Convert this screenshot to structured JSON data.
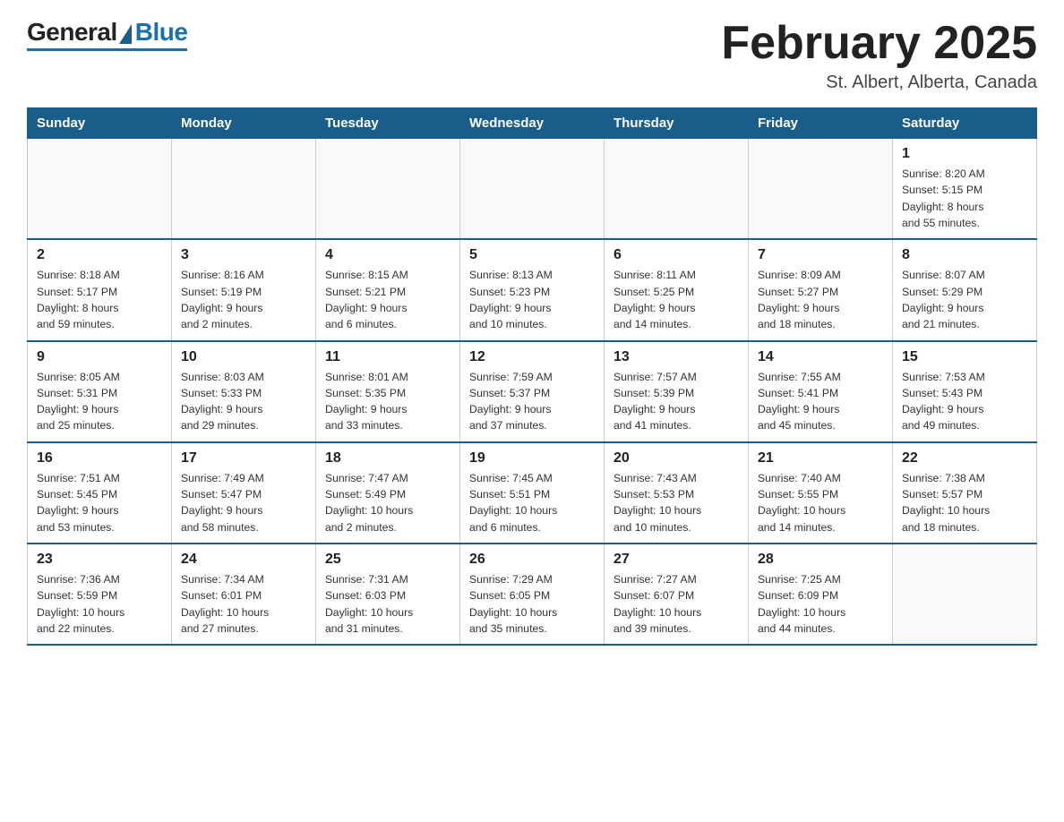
{
  "logo": {
    "general": "General",
    "blue": "Blue"
  },
  "title": "February 2025",
  "location": "St. Albert, Alberta, Canada",
  "days_of_week": [
    "Sunday",
    "Monday",
    "Tuesday",
    "Wednesday",
    "Thursday",
    "Friday",
    "Saturday"
  ],
  "weeks": [
    [
      {
        "day": "",
        "info": ""
      },
      {
        "day": "",
        "info": ""
      },
      {
        "day": "",
        "info": ""
      },
      {
        "day": "",
        "info": ""
      },
      {
        "day": "",
        "info": ""
      },
      {
        "day": "",
        "info": ""
      },
      {
        "day": "1",
        "info": "Sunrise: 8:20 AM\nSunset: 5:15 PM\nDaylight: 8 hours\nand 55 minutes."
      }
    ],
    [
      {
        "day": "2",
        "info": "Sunrise: 8:18 AM\nSunset: 5:17 PM\nDaylight: 8 hours\nand 59 minutes."
      },
      {
        "day": "3",
        "info": "Sunrise: 8:16 AM\nSunset: 5:19 PM\nDaylight: 9 hours\nand 2 minutes."
      },
      {
        "day": "4",
        "info": "Sunrise: 8:15 AM\nSunset: 5:21 PM\nDaylight: 9 hours\nand 6 minutes."
      },
      {
        "day": "5",
        "info": "Sunrise: 8:13 AM\nSunset: 5:23 PM\nDaylight: 9 hours\nand 10 minutes."
      },
      {
        "day": "6",
        "info": "Sunrise: 8:11 AM\nSunset: 5:25 PM\nDaylight: 9 hours\nand 14 minutes."
      },
      {
        "day": "7",
        "info": "Sunrise: 8:09 AM\nSunset: 5:27 PM\nDaylight: 9 hours\nand 18 minutes."
      },
      {
        "day": "8",
        "info": "Sunrise: 8:07 AM\nSunset: 5:29 PM\nDaylight: 9 hours\nand 21 minutes."
      }
    ],
    [
      {
        "day": "9",
        "info": "Sunrise: 8:05 AM\nSunset: 5:31 PM\nDaylight: 9 hours\nand 25 minutes."
      },
      {
        "day": "10",
        "info": "Sunrise: 8:03 AM\nSunset: 5:33 PM\nDaylight: 9 hours\nand 29 minutes."
      },
      {
        "day": "11",
        "info": "Sunrise: 8:01 AM\nSunset: 5:35 PM\nDaylight: 9 hours\nand 33 minutes."
      },
      {
        "day": "12",
        "info": "Sunrise: 7:59 AM\nSunset: 5:37 PM\nDaylight: 9 hours\nand 37 minutes."
      },
      {
        "day": "13",
        "info": "Sunrise: 7:57 AM\nSunset: 5:39 PM\nDaylight: 9 hours\nand 41 minutes."
      },
      {
        "day": "14",
        "info": "Sunrise: 7:55 AM\nSunset: 5:41 PM\nDaylight: 9 hours\nand 45 minutes."
      },
      {
        "day": "15",
        "info": "Sunrise: 7:53 AM\nSunset: 5:43 PM\nDaylight: 9 hours\nand 49 minutes."
      }
    ],
    [
      {
        "day": "16",
        "info": "Sunrise: 7:51 AM\nSunset: 5:45 PM\nDaylight: 9 hours\nand 53 minutes."
      },
      {
        "day": "17",
        "info": "Sunrise: 7:49 AM\nSunset: 5:47 PM\nDaylight: 9 hours\nand 58 minutes."
      },
      {
        "day": "18",
        "info": "Sunrise: 7:47 AM\nSunset: 5:49 PM\nDaylight: 10 hours\nand 2 minutes."
      },
      {
        "day": "19",
        "info": "Sunrise: 7:45 AM\nSunset: 5:51 PM\nDaylight: 10 hours\nand 6 minutes."
      },
      {
        "day": "20",
        "info": "Sunrise: 7:43 AM\nSunset: 5:53 PM\nDaylight: 10 hours\nand 10 minutes."
      },
      {
        "day": "21",
        "info": "Sunrise: 7:40 AM\nSunset: 5:55 PM\nDaylight: 10 hours\nand 14 minutes."
      },
      {
        "day": "22",
        "info": "Sunrise: 7:38 AM\nSunset: 5:57 PM\nDaylight: 10 hours\nand 18 minutes."
      }
    ],
    [
      {
        "day": "23",
        "info": "Sunrise: 7:36 AM\nSunset: 5:59 PM\nDaylight: 10 hours\nand 22 minutes."
      },
      {
        "day": "24",
        "info": "Sunrise: 7:34 AM\nSunset: 6:01 PM\nDaylight: 10 hours\nand 27 minutes."
      },
      {
        "day": "25",
        "info": "Sunrise: 7:31 AM\nSunset: 6:03 PM\nDaylight: 10 hours\nand 31 minutes."
      },
      {
        "day": "26",
        "info": "Sunrise: 7:29 AM\nSunset: 6:05 PM\nDaylight: 10 hours\nand 35 minutes."
      },
      {
        "day": "27",
        "info": "Sunrise: 7:27 AM\nSunset: 6:07 PM\nDaylight: 10 hours\nand 39 minutes."
      },
      {
        "day": "28",
        "info": "Sunrise: 7:25 AM\nSunset: 6:09 PM\nDaylight: 10 hours\nand 44 minutes."
      },
      {
        "day": "",
        "info": ""
      }
    ]
  ]
}
